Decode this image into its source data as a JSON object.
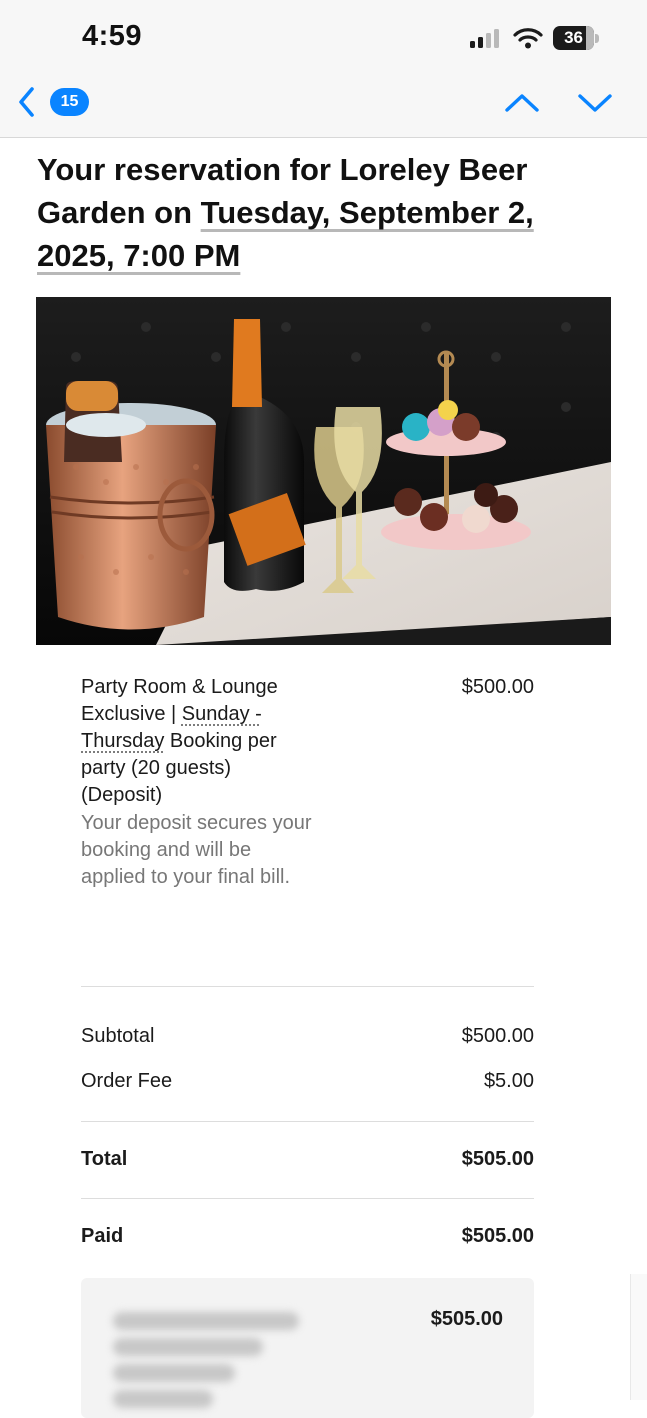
{
  "status_bar": {
    "time": "4:59",
    "battery": "36"
  },
  "toolbar": {
    "unread_count": "15"
  },
  "email": {
    "headline_part1": "Your reservation for Loreley Beer Garden on ",
    "headline_date": "Tuesday, September 2, 2025, 7:00 PM"
  },
  "line_item": {
    "name_part1": "Party Room & Lounge Exclusive | ",
    "name_link": "Sunday - Thursday",
    "name_part2": " Booking per party (20 guests) (Deposit)",
    "description": "Your deposit secures your booking and will be applied to your final bill.",
    "price": "$500.00"
  },
  "summary": {
    "subtotal_label": "Subtotal",
    "subtotal_value": "$500.00",
    "fee_label": "Order Fee",
    "fee_value": "$5.00",
    "total_label": "Total",
    "total_value": "$505.00",
    "paid_label": "Paid",
    "paid_value": "$505.00"
  },
  "payment": {
    "amount": "$505.00"
  },
  "colors": {
    "accent": "#0a84ff",
    "text": "#111111",
    "muted_text": "#777777",
    "toolbar_bg": "#f7f7f7"
  },
  "icons": {
    "back": "chevron-left-icon",
    "prev": "chevron-up-icon",
    "next": "chevron-down-icon",
    "signal": "cellular-signal-icon",
    "wifi": "wifi-icon",
    "battery": "battery-icon"
  }
}
